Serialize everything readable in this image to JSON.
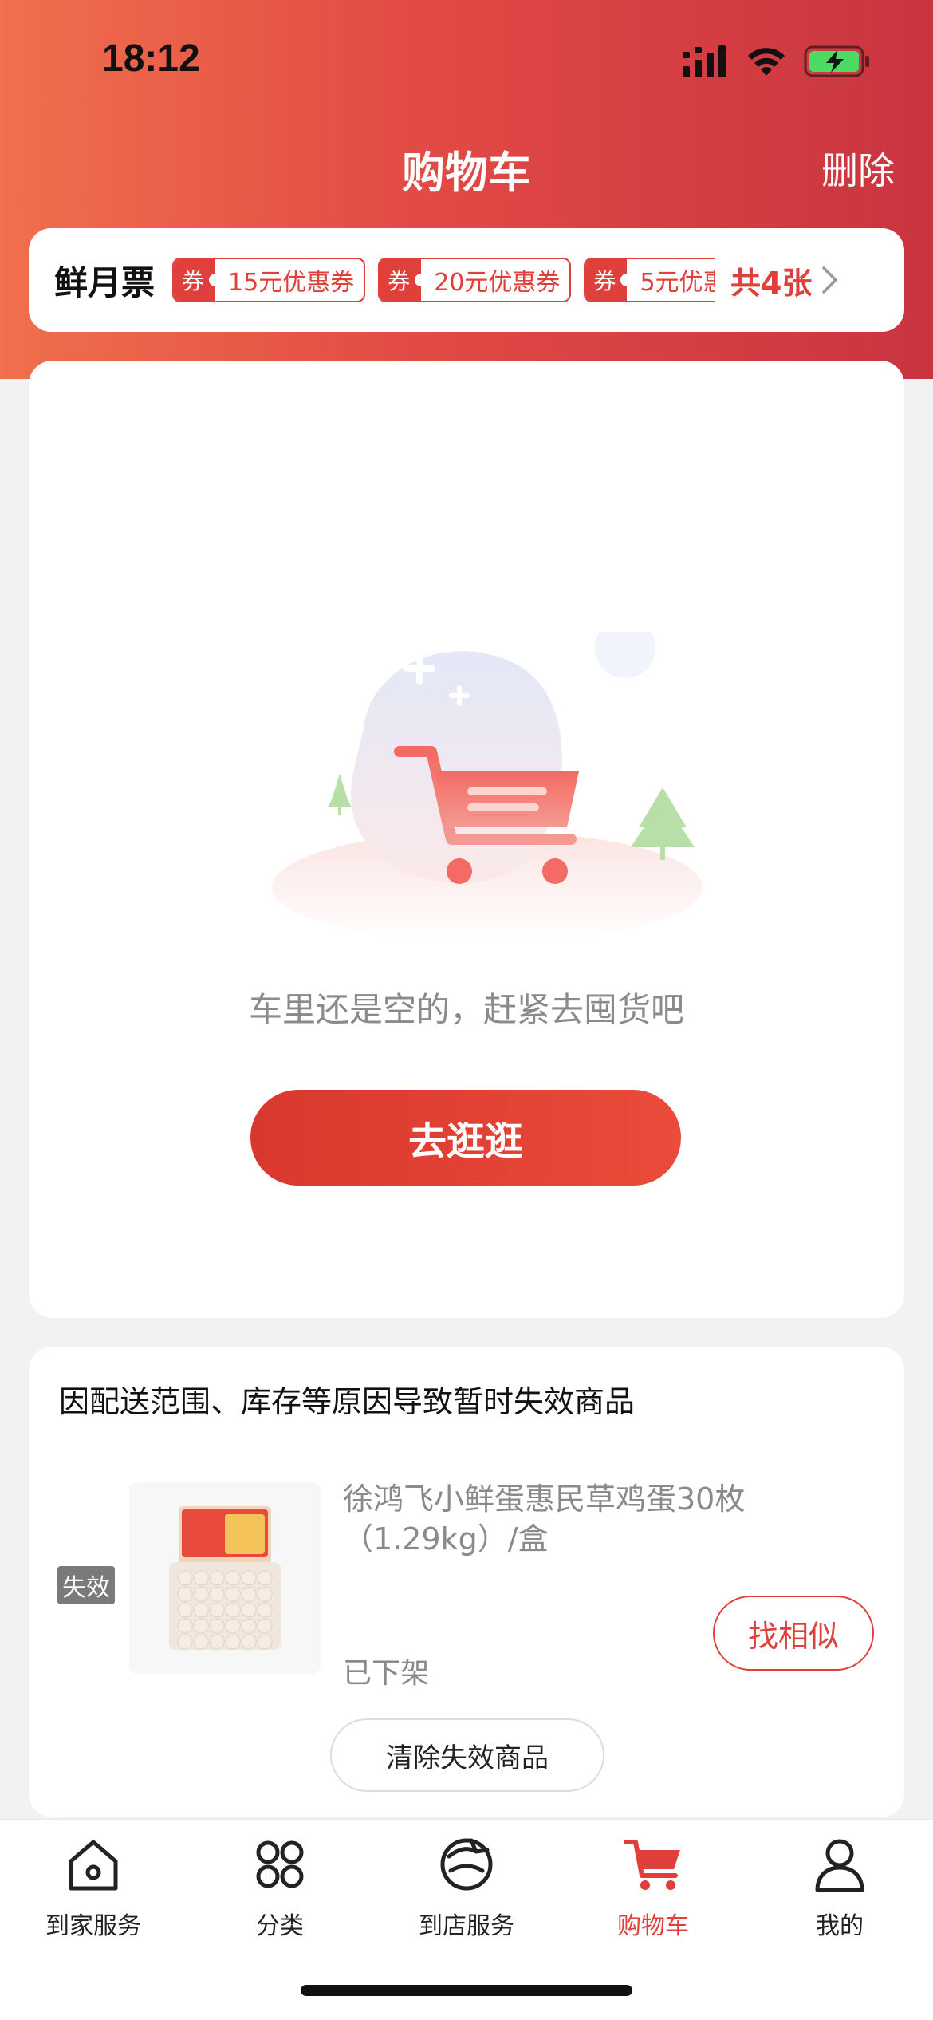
{
  "status_bar": {
    "time": "18:12"
  },
  "header": {
    "title": "购物车",
    "delete_label": "删除"
  },
  "coupons": {
    "label": "鲜月票",
    "tag": "券",
    "items": [
      {
        "text": "15元优惠券"
      },
      {
        "text": "20元优惠券"
      },
      {
        "text": "5元优惠"
      }
    ],
    "total": "共4张"
  },
  "empty_cart": {
    "message": "车里还是空的，赶紧去囤货吧",
    "button_label": "去逛逛"
  },
  "invalid_section": {
    "heading": "因配送范围、库存等原因导致暂时失效商品",
    "badge": "失效",
    "product": {
      "title": "徐鸿飞小鲜蛋惠民草鸡蛋30枚（1.29kg）/盒",
      "status": "已下架",
      "find_similar_label": "找相似"
    },
    "clear_label": "清除失效商品"
  },
  "tab_bar": {
    "items": [
      {
        "label": "到家服务",
        "icon": "home-icon"
      },
      {
        "label": "分类",
        "icon": "category-icon"
      },
      {
        "label": "到店服务",
        "icon": "store-service-icon"
      },
      {
        "label": "购物车",
        "icon": "cart-icon",
        "active": true
      },
      {
        "label": "我的",
        "icon": "profile-icon"
      }
    ]
  },
  "colors": {
    "accent": "#e0403c",
    "header_start": "#f06f4d",
    "header_end": "#c9343f"
  }
}
